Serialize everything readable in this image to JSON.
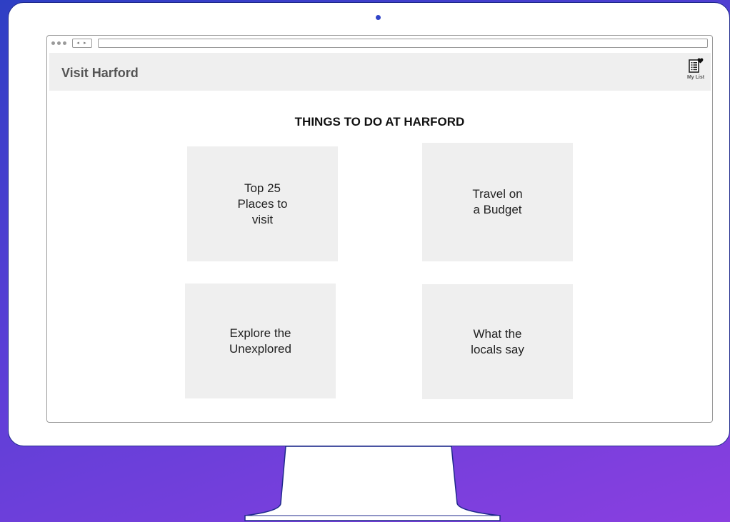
{
  "browser": {
    "nav_arrows": "◂ ▸"
  },
  "header": {
    "site_title": "Visit Harford",
    "my_list_label": "My List",
    "my_list_icon": "list-heart-icon"
  },
  "main": {
    "heading": "THINGS TO DO AT HARFORD",
    "tiles": [
      {
        "label": "Top 25\nPlaces to\nvisit"
      },
      {
        "label": "Travel on\na Budget"
      },
      {
        "label": "Explore the\nUnexplored"
      },
      {
        "label": "What the\nlocals say"
      }
    ]
  },
  "colors": {
    "background_start": "#2e3fc4",
    "background_end": "#8a3fe0",
    "monitor_outline": "#1f2a8c",
    "header_bg": "#efefef",
    "tile_bg": "#efefef",
    "title_text": "#555555"
  }
}
